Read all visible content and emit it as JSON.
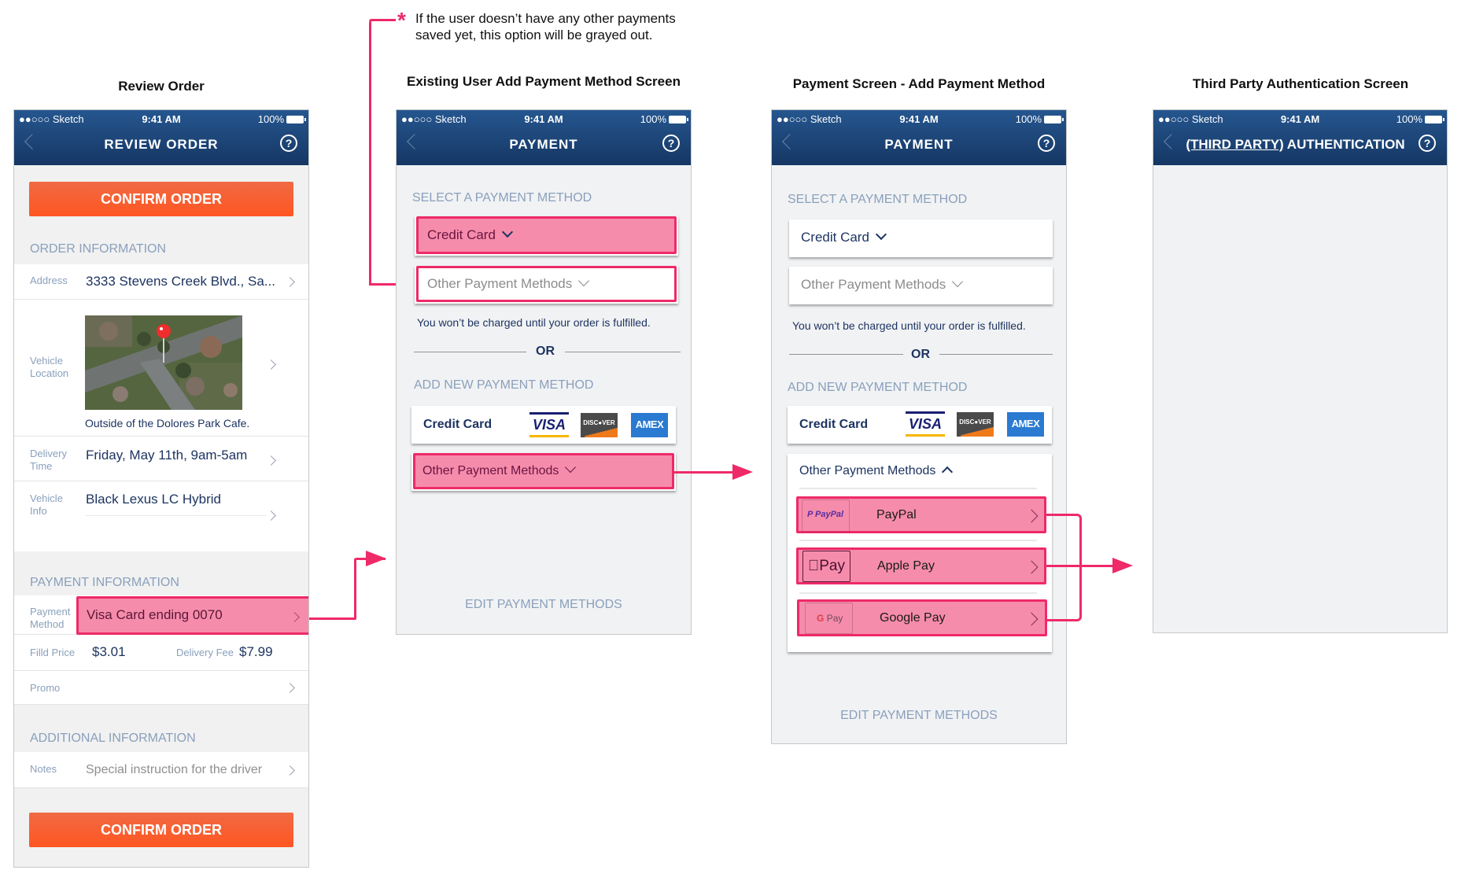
{
  "annotation": {
    "asterisk": "*",
    "note_line1": "If the user doesn’t have any other payments",
    "note_line2": "saved yet, this option will be grayed out."
  },
  "status_bar": {
    "carrier": "●●○○○ Sketch",
    "time": "9:41 AM",
    "battery": "100%"
  },
  "colors": {
    "nav_gradient_top": "#25568f",
    "nav_gradient_bottom": "#163764",
    "cta_orange": "#ff5622",
    "highlight_pink": "#ee2a68",
    "section_header": "#8aa0bc",
    "text_navy": "#1d3461"
  },
  "screens": {
    "review_order": {
      "caption": "Review Order",
      "nav_title": "REVIEW ORDER",
      "confirm_label": "CONFIRM ORDER",
      "order_info_header": "ORDER INFORMATION",
      "address_label": "Address",
      "address_value": "3333 Stevens Creek Blvd., Sa...",
      "vehicle_location_label_1": "Vehicle",
      "vehicle_location_label_2": "Location",
      "location_caption": "Outside of the Dolores Park Cafe.",
      "delivery_time_label_1": "Delivery",
      "delivery_time_label_2": "Time",
      "delivery_time_value": "Friday, May 11th, 9am-5am",
      "vehicle_info_label_1": "Vehicle",
      "vehicle_info_label_2": "Info",
      "vehicle_info_value": "Black Lexus LC Hybrid",
      "payment_info_header": "PAYMENT INFORMATION",
      "payment_method_label_1": "Payment",
      "payment_method_label_2": "Method",
      "payment_method_value": "Visa Card ending 0070",
      "filld_price_label": "Filld Price",
      "filld_price_value": "$3.01",
      "delivery_fee_label": "Delivery Fee",
      "delivery_fee_value": "$7.99",
      "promo_label": "Promo",
      "additional_info_header": "ADDITIONAL INFORMATION",
      "notes_label": "Notes",
      "notes_placeholder": "Special instruction for the driver",
      "confirm_label_bottom": "CONFIRM ORDER"
    },
    "existing_user_payment": {
      "caption": "Existing User Add Payment Method Screen",
      "nav_title": "PAYMENT",
      "select_header": "SELECT A PAYMENT METHOD",
      "credit_card_option": "Credit Card",
      "other_methods_option": "Other Payment Methods",
      "charge_note": "You won’t be charged until your order is fulfilled.",
      "or_label": "OR",
      "add_new_header": "ADD NEW PAYMENT METHOD",
      "add_credit_card": "Credit Card",
      "add_other_methods": "Other Payment Methods",
      "edit_link": "EDIT PAYMENT METHODS"
    },
    "payment_add_method": {
      "caption": "Payment Screen - Add Payment Method",
      "nav_title": "PAYMENT",
      "select_header": "SELECT A PAYMENT METHOD",
      "credit_card_option": "Credit Card",
      "other_methods_option": "Other Payment Methods",
      "charge_note": "You won’t be charged until your order is fulfilled.",
      "or_label": "OR",
      "add_new_header": "ADD NEW PAYMENT METHOD",
      "add_credit_card": "Credit Card",
      "other_methods_expanded": "Other Payment Methods",
      "methods": [
        {
          "name": "PayPal",
          "logo_text": "PayPal"
        },
        {
          "name": "Apple Pay",
          "logo_text": "Pay"
        },
        {
          "name": "Google Pay",
          "logo_text": "Pay"
        }
      ],
      "edit_link": "EDIT PAYMENT METHODS"
    },
    "third_party_auth": {
      "caption": "Third Party Authentication Screen",
      "nav_title_underlined": "(THIRD PARTY)",
      "nav_title_rest": " AUTHENTICATION"
    }
  },
  "card_logos": {
    "visa": "VISA",
    "discover": "DISC●VER",
    "amex": "AMEX"
  }
}
